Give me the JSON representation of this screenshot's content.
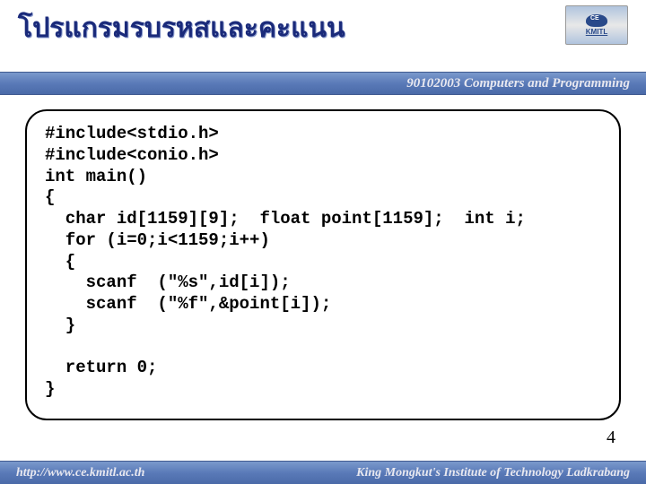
{
  "header": {
    "title": "โปรแกรมรบรหสและคะแนน",
    "course_label": "90102003 Computers and Programming",
    "logo_abbr": "KMITL"
  },
  "code": {
    "lines": "#include<stdio.h>\n#include<conio.h>\nint main()\n{\n  char id[1159][9];  float point[1159];  int i;\n  for (i=0;i<1159;i++)\n  {\n    scanf  (\"%s\",id[i]);\n    scanf  (\"%f\",&point[i]);\n  }\n\n  return 0;\n}"
  },
  "page_number": "4",
  "footer": {
    "left": "http://www.ce.kmitl.ac.th",
    "right": "King Mongkut's Institute of Technology Ladkrabang"
  }
}
